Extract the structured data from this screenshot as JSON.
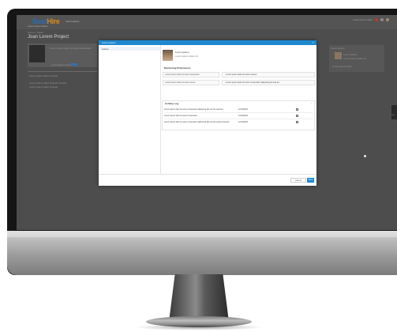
{
  "app": {
    "logo_main": "Best",
    "logo_accent": "Hire",
    "logo_sub": "Lorem ipsum",
    "nav_text": "Lorem  Ipsum  Dolor",
    "header_right_text": "Lorem ipsum dolor"
  },
  "background_page": {
    "breadcrumb": "Lorem > Ipsum",
    "title": "Joan Lorem Project",
    "line1": "Lorem ipsum dolor sit amet consectetur",
    "line2": "Lorem ipsum  Lorem",
    "section_label": "Lorem ipsum dolor sit amet",
    "text_a": "Lorem ipsum dolor sit amet consect",
    "text_b": "Lorem ipsum dolor sit amet",
    "right_panel_title": "Lorem ipsum",
    "right_panel_name": "Lorem ipsum",
    "right_panel_sub": "Lorem ipsum dolor sit",
    "right_panel_note": "Lorem ipsum dolor",
    "side_tab": "Help"
  },
  "modal": {
    "title": "Lorem Ipsum",
    "close_glyph": "×",
    "nav_item": "Lorem",
    "profile_name": "Lorem Ipsum",
    "profile_sub": "Lorem ipsum dolor sit",
    "section_info_title": "Monitoring Preferences",
    "fields": [
      {
        "label": "Lorem ipsum dolor sit amet consectetur",
        "value": "Lorem ipsum dolor sit amet consect"
      },
      {
        "label": "Lorem ipsum dolor sit amet consec",
        "value": "Lorem ipsum dolor sit amet consectetur adipiscing elit sed do"
      }
    ],
    "activity_title": "Activity Log",
    "activity_chevron": "^",
    "activity_rows": [
      {
        "text": "Lorem ipsum dolor sit amet consectetur adipiscing elit sed do eiusmod",
        "date": "12/13/2016"
      },
      {
        "text": "Lorem ipsum dolor sit amet consectetur",
        "date": "12/13/2016"
      },
      {
        "text": "Lorem ipsum dolor sit amet consectetur adipiscing elit sed do eiusmod tempor",
        "date": "12/13/2016"
      }
    ],
    "cancel_label": "Cancel",
    "save_label": "Save"
  },
  "colors": {
    "accent": "#1e88cf",
    "logo_blue": "#2b6cb3",
    "logo_orange": "#d98a1c"
  }
}
